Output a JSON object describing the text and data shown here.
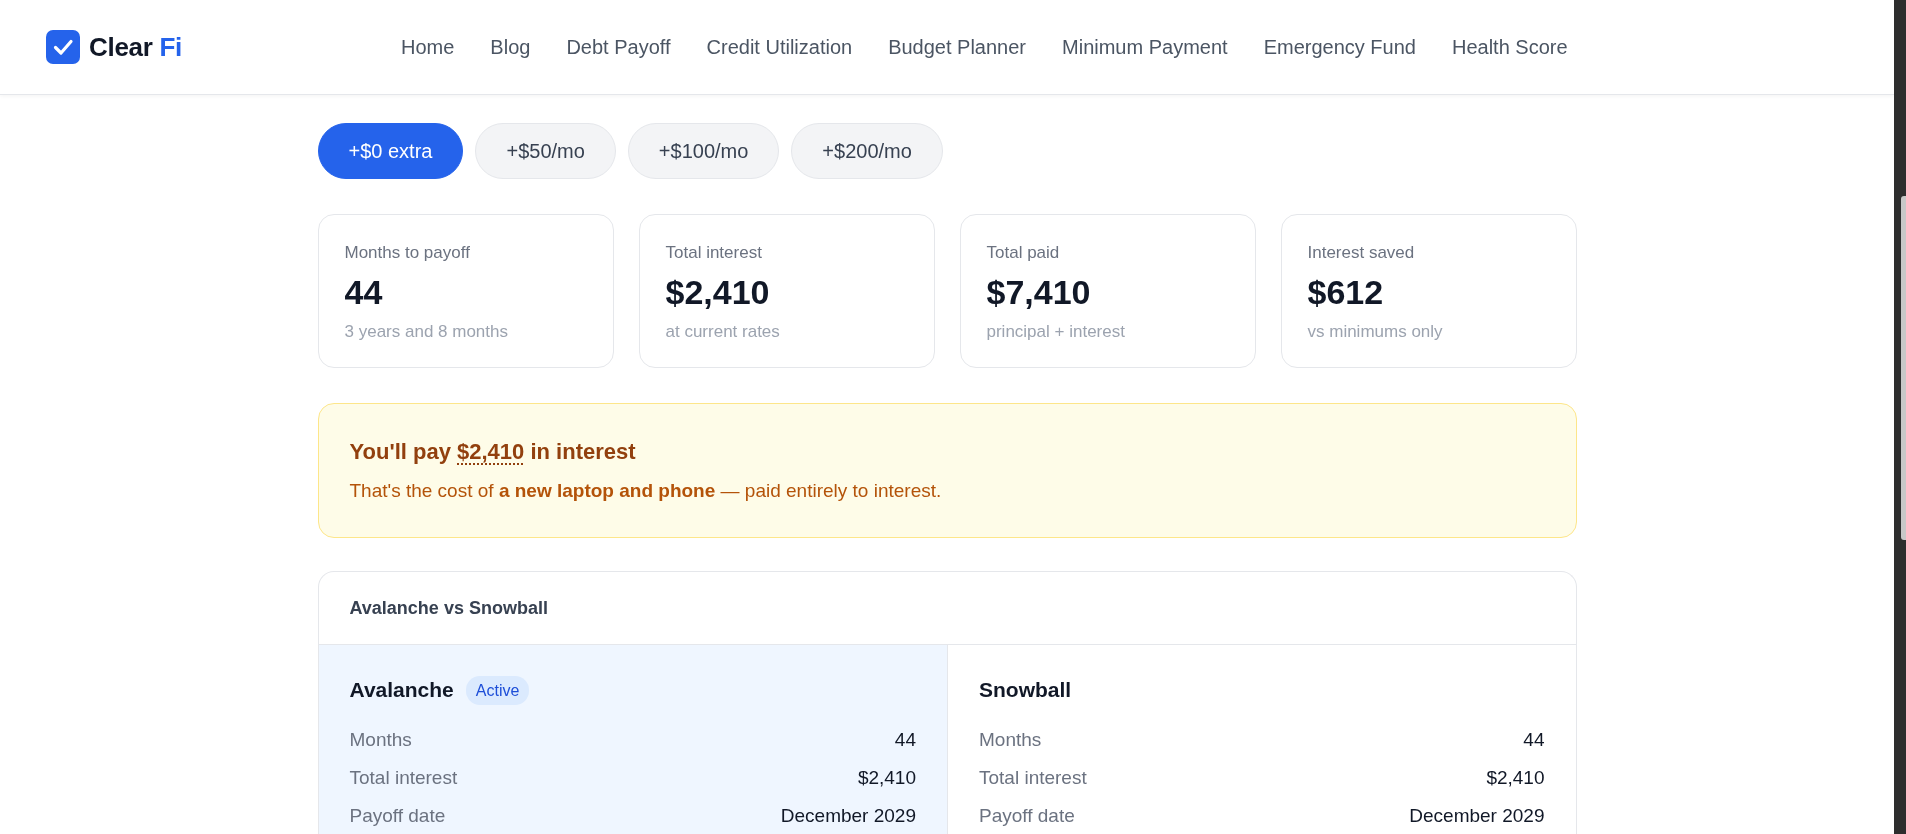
{
  "brand": {
    "name_parts": [
      {
        "kind": "plain",
        "text": "Clear"
      },
      {
        "kind": "accent",
        "text": "Fi"
      }
    ]
  },
  "nav": [
    "Home",
    "Blog",
    "Debt Payoff",
    "Credit Utilization",
    "Budget Planner",
    "Minimum Payment",
    "Emergency Fund",
    "Health Score"
  ],
  "extra_payment_options": [
    {
      "label": "+$0 extra",
      "selected": true
    },
    {
      "label": "+$50/mo",
      "selected": false
    },
    {
      "label": "+$100/mo",
      "selected": false
    },
    {
      "label": "+$200/mo",
      "selected": false
    }
  ],
  "stats": [
    {
      "label": "Months to payoff",
      "value": "44",
      "note": "3 years and 8 months"
    },
    {
      "label": "Total interest",
      "value": "$2,410",
      "note": "at current rates"
    },
    {
      "label": "Total paid",
      "value": "$7,410",
      "note": "principal + interest"
    },
    {
      "label": "Interest saved",
      "value": "$612",
      "note": "vs minimums only"
    }
  ],
  "alert": {
    "title_parts": [
      {
        "kind": "plain",
        "text": "You'll pay "
      },
      {
        "kind": "amount",
        "text": "$2,410"
      },
      {
        "kind": "plain",
        "text": " in interest"
      }
    ],
    "message": "That's the cost of **a new laptop and phone** — paid entirely to interest."
  },
  "comparison": {
    "title": "Avalanche vs Snowball",
    "strategies": [
      {
        "name": "Avalanche",
        "selected": true,
        "badge": "Active",
        "rows": [
          {
            "label": "Months",
            "value": "44"
          },
          {
            "label": "Total interest",
            "value": "$2,410"
          },
          {
            "label": "Payoff date",
            "value": "December 2029"
          }
        ]
      },
      {
        "name": "Snowball",
        "selected": false,
        "rows": [
          {
            "label": "Months",
            "value": "44"
          },
          {
            "label": "Total interest",
            "value": "$2,410"
          },
          {
            "label": "Payoff date",
            "value": "December 2029"
          }
        ]
      }
    ]
  }
}
